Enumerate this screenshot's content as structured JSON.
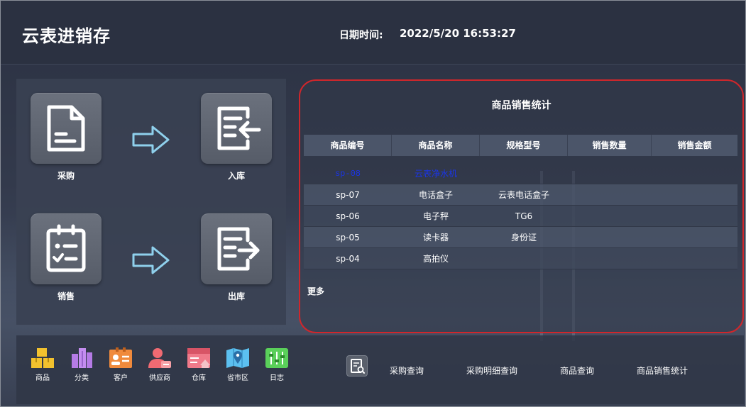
{
  "header": {
    "app_title": "云表进销存",
    "datetime_label": "日期时间:",
    "datetime_value": "2022/5/20 16:53:27"
  },
  "workflow": {
    "purchase_label": "采购",
    "stock_in_label": "入库",
    "sales_label": "销售",
    "stock_out_label": "出库"
  },
  "stats": {
    "title": "商品销售统计",
    "columns": [
      "商品编号",
      "商品名称",
      "规格型号",
      "销售数量",
      "销售金额"
    ],
    "rows": [
      [
        "sp-08",
        "云表净水机",
        "",
        "",
        ""
      ],
      [
        "sp-07",
        "电话盒子",
        "云表电话盒子",
        "",
        ""
      ],
      [
        "sp-06",
        "电子秤",
        "TG6",
        "",
        ""
      ],
      [
        "sp-05",
        "读卡器",
        "身份证",
        "",
        ""
      ],
      [
        "sp-04",
        "高拍仪",
        "",
        "",
        ""
      ]
    ],
    "more_label": "更多"
  },
  "modules": [
    {
      "label": "商品",
      "icon": "goods-boxes-icon",
      "color": "#f2c12e"
    },
    {
      "label": "分类",
      "icon": "category-buildings-icon",
      "color": "#b57be6"
    },
    {
      "label": "客户",
      "icon": "customer-card-icon",
      "color": "#f08a3c"
    },
    {
      "label": "供应商",
      "icon": "supplier-person-icon",
      "color": "#f06a72"
    },
    {
      "label": "仓库",
      "icon": "warehouse-icon",
      "color": "#f07a8a"
    },
    {
      "label": "省市区",
      "icon": "map-pin-icon",
      "color": "#5cc0f0"
    },
    {
      "label": "日志",
      "icon": "log-sliders-icon",
      "color": "#5ad05a"
    }
  ],
  "query_links": {
    "purchase_query": "采购查询",
    "purchase_detail_query": "采购明细查询",
    "goods_query": "商品查询",
    "sales_stats": "商品销售统计"
  },
  "colors": {
    "highlight_border": "#d0262b",
    "first_row_text": "#1a35e8"
  }
}
